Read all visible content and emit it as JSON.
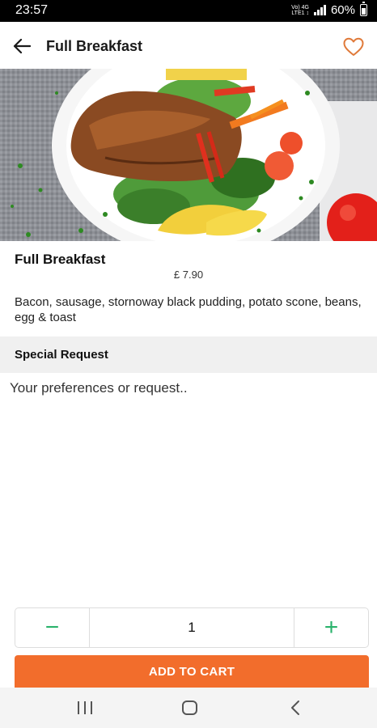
{
  "status_bar": {
    "time": "23:57",
    "net_top": "Vo) 4G",
    "net_bottom": "LTE1 ↕",
    "battery": "60%"
  },
  "header": {
    "title": "Full Breakfast",
    "back_icon": "arrow-left-icon",
    "favorite_icon": "heart-outline-icon"
  },
  "product": {
    "name": "Full Breakfast",
    "price": "£ 7.90",
    "description": "Bacon, sausage, stornoway black pudding, potato scone, beans, egg & toast"
  },
  "special_request": {
    "title": "Special Request",
    "placeholder": "Your preferences or request.."
  },
  "quantity": {
    "minus": "−",
    "value": "1",
    "plus": "+"
  },
  "add_to_cart": "ADD TO CART",
  "colors": {
    "accent": "#f26d2c",
    "stepper_green": "#2bb36c",
    "heart": "#e07a3a"
  },
  "nav_bar": {
    "recents_icon": "recents-icon",
    "home_icon": "home-icon",
    "back_icon": "nav-back-icon"
  }
}
